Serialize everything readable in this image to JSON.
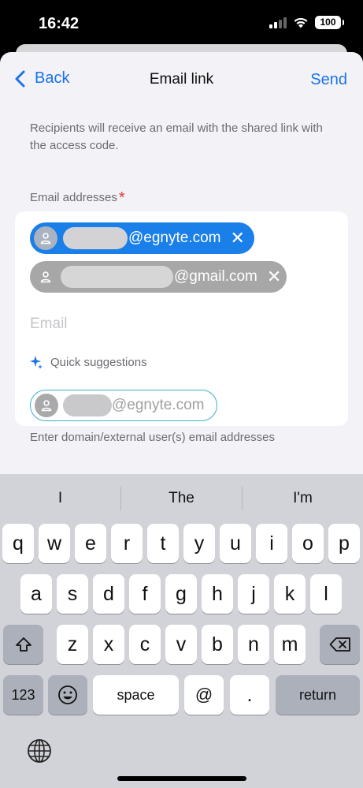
{
  "status": {
    "time": "16:42",
    "battery": "100"
  },
  "nav": {
    "back_label": "Back",
    "title": "Email link",
    "send_label": "Send"
  },
  "description": "Recipients will receive an email with the shared link with the access code.",
  "field": {
    "label": "Email addresses",
    "required_mark": "*"
  },
  "chips": [
    {
      "domain": "@egnyte.com",
      "remove": "✕"
    },
    {
      "domain": "@gmail.com",
      "remove": "✕"
    }
  ],
  "email_input": {
    "placeholder": "Email",
    "value": ""
  },
  "quick_suggestions": {
    "label": "Quick suggestions",
    "items": [
      {
        "domain": "@egnyte.com"
      }
    ]
  },
  "hint": "Enter domain/external user(s) email addresses",
  "keyboard": {
    "predictions": [
      "I",
      "The",
      "I'm"
    ],
    "row1": [
      "q",
      "w",
      "e",
      "r",
      "t",
      "y",
      "u",
      "i",
      "o",
      "p"
    ],
    "row2": [
      "a",
      "s",
      "d",
      "f",
      "g",
      "h",
      "j",
      "k",
      "l"
    ],
    "row3": [
      "z",
      "x",
      "c",
      "v",
      "b",
      "n",
      "m"
    ],
    "bottom": {
      "numbers": "123",
      "space": "space",
      "at": "@",
      "dot": ".",
      "return": "return"
    }
  },
  "colors": {
    "accent": "#1a73e8",
    "chip_blue": "#1a7fe8",
    "chip_gray": "#a7a7a7",
    "required": "#e53935"
  }
}
